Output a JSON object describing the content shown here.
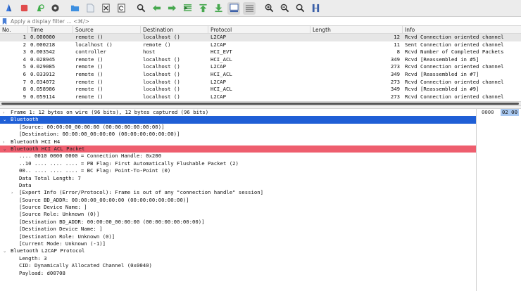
{
  "toolbar": {
    "buttons": [
      {
        "name": "start-capture-icon",
        "color": "#3d7be0"
      },
      {
        "name": "stop-capture-icon",
        "color": "#e04b4b"
      },
      {
        "name": "restart-capture-icon",
        "color": "#3fae4a"
      },
      {
        "name": "capture-options-icon",
        "color": "#444444"
      },
      {
        "name": "open-file-icon",
        "color": "#3d8fe0"
      },
      {
        "name": "save-file-icon",
        "color": "#9aa6b5"
      },
      {
        "name": "close-file-icon",
        "color": "#444444"
      },
      {
        "name": "reload-file-icon",
        "color": "#444444"
      },
      {
        "name": "find-packet-icon",
        "color": "#333333"
      },
      {
        "name": "go-back-icon",
        "color": "#47a84f"
      },
      {
        "name": "go-forward-icon",
        "color": "#47a84f"
      },
      {
        "name": "go-to-packet-icon",
        "color": "#47a84f"
      },
      {
        "name": "go-first-icon",
        "color": "#47a84f"
      },
      {
        "name": "go-last-icon",
        "color": "#47a84f"
      },
      {
        "name": "auto-scroll-icon",
        "color": "#3a5fa8"
      },
      {
        "name": "colorize-icon",
        "color": "#888888"
      },
      {
        "name": "zoom-in-icon",
        "color": "#333333"
      },
      {
        "name": "zoom-out-icon",
        "color": "#333333"
      },
      {
        "name": "normal-size-icon",
        "color": "#333333"
      },
      {
        "name": "resize-columns-icon",
        "color": "#3a5fa8"
      }
    ]
  },
  "filter": {
    "placeholder": "Apply a display filter … <⌘/>"
  },
  "packet_list": {
    "columns": [
      "No.",
      "Time",
      "Source",
      "Destination",
      "Protocol",
      "Length",
      "Info"
    ],
    "rows": [
      {
        "no": "1",
        "time": "0.000000",
        "src": "remote ()",
        "dst": "localhost ()",
        "proto": "L2CAP",
        "len": "12",
        "info": "Rcvd Connection oriented channel"
      },
      {
        "no": "2",
        "time": "0.000218",
        "src": "localhost ()",
        "dst": "remote ()",
        "proto": "L2CAP",
        "len": "11",
        "info": "Sent Connection oriented channel"
      },
      {
        "no": "3",
        "time": "0.003542",
        "src": "controller",
        "dst": "host",
        "proto": "HCI_EVT",
        "len": "8",
        "info": "Rcvd Number of Completed Packets"
      },
      {
        "no": "4",
        "time": "0.028945",
        "src": "remote ()",
        "dst": "localhost ()",
        "proto": "HCI_ACL",
        "len": "349",
        "info": "Rcvd  [Reassembled in #5]"
      },
      {
        "no": "5",
        "time": "0.029085",
        "src": "remote ()",
        "dst": "localhost ()",
        "proto": "L2CAP",
        "len": "273",
        "info": "Rcvd Connection oriented channel"
      },
      {
        "no": "6",
        "time": "0.033912",
        "src": "remote ()",
        "dst": "localhost ()",
        "proto": "HCI_ACL",
        "len": "349",
        "info": "Rcvd  [Reassembled in #7]"
      },
      {
        "no": "7",
        "time": "0.034072",
        "src": "remote ()",
        "dst": "localhost ()",
        "proto": "L2CAP",
        "len": "273",
        "info": "Rcvd Connection oriented channel"
      },
      {
        "no": "8",
        "time": "0.058986",
        "src": "remote ()",
        "dst": "localhost ()",
        "proto": "HCI_ACL",
        "len": "349",
        "info": "Rcvd  [Reassembled in #9]"
      },
      {
        "no": "9",
        "time": "0.059114",
        "src": "remote ()",
        "dst": "localhost ()",
        "proto": "L2CAP",
        "len": "273",
        "info": "Rcvd Connection oriented channel"
      }
    ]
  },
  "details": {
    "lines": [
      {
        "text": "Frame 1: 12 bytes on wire (96 bits), 12 bytes captured (96 bits)",
        "indent": 0,
        "twisty": "›",
        "style": ""
      },
      {
        "text": "Bluetooth",
        "indent": 0,
        "twisty": "⌄",
        "style": "bt"
      },
      {
        "text": "[Source: 00:00:00_00:00:00 (00:00:00:00:00:00)]",
        "indent": 1,
        "twisty": "",
        "style": ""
      },
      {
        "text": "[Destination: 00:00:00_00:00:00 (00:00:00:00:00:00)]",
        "indent": 1,
        "twisty": "",
        "style": ""
      },
      {
        "text": "Bluetooth HCI H4",
        "indent": 0,
        "twisty": "›",
        "style": ""
      },
      {
        "text": "Bluetooth HCI ACL Packet",
        "indent": 0,
        "twisty": "⌄",
        "style": "acl"
      },
      {
        "text": ".... 0010 0000 0000 = Connection Handle: 0x200",
        "indent": 1,
        "twisty": "",
        "style": ""
      },
      {
        "text": "..10 .... .... .... = PB Flag: First Automatically Flushable Packet (2)",
        "indent": 1,
        "twisty": "",
        "style": ""
      },
      {
        "text": "00.. .... .... .... = BC Flag: Point-To-Point (0)",
        "indent": 1,
        "twisty": "",
        "style": ""
      },
      {
        "text": "Data Total Length: 7",
        "indent": 1,
        "twisty": "",
        "style": ""
      },
      {
        "text": "Data",
        "indent": 1,
        "twisty": "",
        "style": ""
      },
      {
        "text": "[Expert Info (Error/Protocol): Frame is out of any \"connection handle\" session]",
        "indent": 1,
        "twisty": "›",
        "style": ""
      },
      {
        "text": "[Source BD_ADDR: 00:00:00_00:00:00 (00:00:00:00:00:00)]",
        "indent": 1,
        "twisty": "",
        "style": ""
      },
      {
        "text": "[Source Device Name: ]",
        "indent": 1,
        "twisty": "",
        "style": ""
      },
      {
        "text": "[Source Role: Unknown (0)]",
        "indent": 1,
        "twisty": "",
        "style": ""
      },
      {
        "text": "[Destination BD_ADDR: 00:00:00_00:00:00 (00:00:00:00:00:00)]",
        "indent": 1,
        "twisty": "",
        "style": ""
      },
      {
        "text": "[Destination Device Name: ]",
        "indent": 1,
        "twisty": "",
        "style": ""
      },
      {
        "text": "[Destination Role: Unknown (0)]",
        "indent": 1,
        "twisty": "",
        "style": ""
      },
      {
        "text": "[Current Mode: Unknown (-1)]",
        "indent": 1,
        "twisty": "",
        "style": ""
      },
      {
        "text": "Bluetooth L2CAP Protocol",
        "indent": 0,
        "twisty": "⌄",
        "style": ""
      },
      {
        "text": "Length: 3",
        "indent": 1,
        "twisty": "",
        "style": ""
      },
      {
        "text": "CID: Dynamically Allocated Channel (0x0040)",
        "indent": 1,
        "twisty": "",
        "style": ""
      },
      {
        "text": "Payload: d00708",
        "indent": 1,
        "twisty": "",
        "style": ""
      }
    ]
  },
  "bytes": {
    "offset": "0000",
    "hex": "02 00"
  },
  "colors": {
    "selected_tree": "#1f5fd6",
    "error_tree": "#ee5e6e",
    "bytes_highlight": "#a9c9f2"
  }
}
